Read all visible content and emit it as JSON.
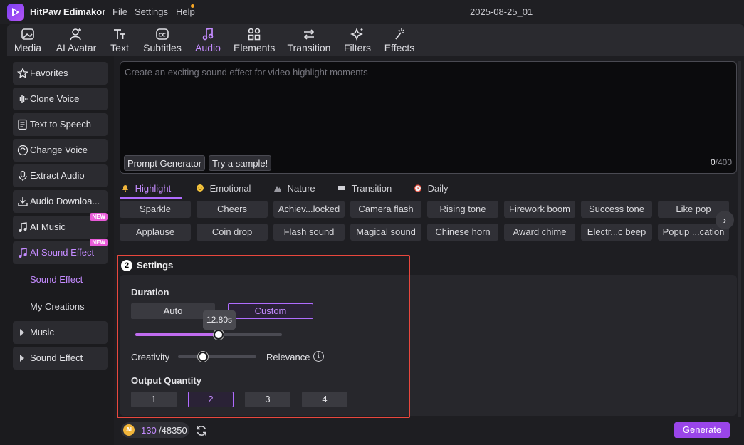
{
  "app": {
    "name": "HitPaw Edimakor",
    "menus": [
      "File",
      "Settings",
      "Help"
    ],
    "project": "2025-08-25_01"
  },
  "tools": [
    {
      "label": "Media",
      "icon": "media-icon"
    },
    {
      "label": "AI Avatar",
      "icon": "ai-avatar-icon"
    },
    {
      "label": "Text",
      "icon": "text-icon"
    },
    {
      "label": "Subtitles",
      "icon": "subtitles-icon"
    },
    {
      "label": "Audio",
      "icon": "audio-icon",
      "active": true
    },
    {
      "label": "Elements",
      "icon": "elements-icon"
    },
    {
      "label": "Transition",
      "icon": "transition-icon"
    },
    {
      "label": "Filters",
      "icon": "filters-icon"
    },
    {
      "label": "Effects",
      "icon": "effects-icon"
    }
  ],
  "sidebar": {
    "items": [
      {
        "label": "Favorites",
        "icon": "star-icon"
      },
      {
        "label": "Clone Voice",
        "icon": "waveform-icon"
      },
      {
        "label": "Text to Speech",
        "icon": "text-to-speech-icon"
      },
      {
        "label": "Change Voice",
        "icon": "change-voice-icon"
      },
      {
        "label": "Extract Audio",
        "icon": "microphone-icon"
      },
      {
        "label": "Audio Downloa...",
        "icon": "download-icon"
      },
      {
        "label": "AI Music",
        "icon": "ai-music-icon",
        "badge": "NEW"
      },
      {
        "label": "AI Sound Effect",
        "icon": "ai-sound-effect-icon",
        "badge": "NEW",
        "active": true
      }
    ],
    "sub_items": [
      "Sound Effect",
      "My Creations"
    ],
    "groups": [
      "Music",
      "Sound Effect"
    ]
  },
  "prompt": {
    "placeholder": "Create an exciting sound effect for video highlight moments",
    "prompt_generator": "Prompt Generator",
    "try_sample": "Try a sample!",
    "count": "0",
    "max": "/400"
  },
  "categories": [
    {
      "label": "Highlight",
      "icon": "bell-icon",
      "active": true
    },
    {
      "label": "Emotional",
      "icon": "emoji-icon"
    },
    {
      "label": "Nature",
      "icon": "mountain-icon"
    },
    {
      "label": "Transition",
      "icon": "film-icon"
    },
    {
      "label": "Daily",
      "icon": "alarm-clock-icon"
    }
  ],
  "chips_row1": [
    "Sparkle",
    "Cheers",
    "Achiev...locked",
    "Camera flash",
    "Rising tone",
    "Firework boom",
    "Success tone",
    "Like pop"
  ],
  "chips_row2": [
    "Applause",
    "Coin drop",
    "Flash sound",
    "Magical sound",
    "Chinese horn",
    "Award chime",
    "Electr...c beep",
    "Popup ...cation"
  ],
  "settings": {
    "step": "2",
    "title": "Settings",
    "duration_label": "Duration",
    "auto": "Auto",
    "custom": "Custom",
    "duration_value": "12.80s",
    "duration_fraction": 0.57,
    "creativity": "Creativity",
    "relevance": "Relevance",
    "creativity_fraction": 0.32,
    "output_quantity": "Output Quantity",
    "quantities": [
      "1",
      "2",
      "3",
      "4"
    ],
    "selected_quantity": "2"
  },
  "footer": {
    "coin_label": "AI",
    "credits_used": "130",
    "credits_total": "/48350",
    "generate": "Generate"
  },
  "colors": {
    "accent": "#c48bff",
    "primary_button": "#9a45ea",
    "highlight_border": "#e9473d"
  }
}
